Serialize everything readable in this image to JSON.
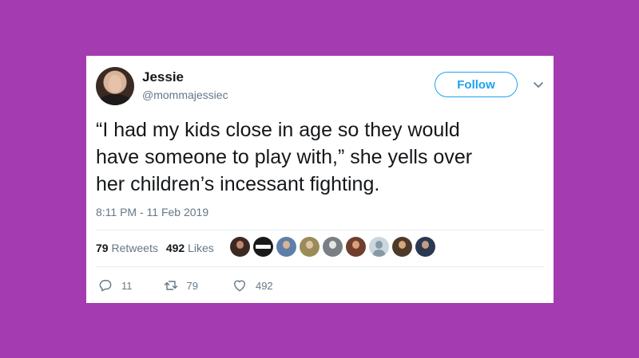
{
  "tweet": {
    "author_name": "Jessie",
    "author_handle": "@mommajessiec",
    "follow_label": "Follow",
    "text": "“I had my kids close in age so they would\nhave someone to play with,” she yells over\nher children’s incessant fighting.",
    "timestamp": "8:11 PM - 11 Feb 2019",
    "retweets_count": "79",
    "retweets_label": "Retweets",
    "likes_count": "492",
    "likes_label": "Likes",
    "reply_action_count": "11",
    "retweet_action_count": "79",
    "like_action_count": "492"
  },
  "likers": [
    {
      "icon": "avatar",
      "bg": "#3b2a22",
      "fg": "#c08a6a"
    },
    {
      "icon": "stamp-logo",
      "bg": "#1a1a1a",
      "fg": "#ffffff"
    },
    {
      "icon": "avatar",
      "bg": "#5f7fa8",
      "fg": "#d7b49a"
    },
    {
      "icon": "avatar",
      "bg": "#9a8b5a",
      "fg": "#e0c3a4"
    },
    {
      "icon": "avatar",
      "bg": "#7a7f86",
      "fg": "#e6e6e6"
    },
    {
      "icon": "avatar",
      "bg": "#6e3f2e",
      "fg": "#e09d7b"
    },
    {
      "icon": "default-avatar",
      "bg": "#ccd6dd",
      "fg": "#8899a6"
    },
    {
      "icon": "avatar",
      "bg": "#4d3a2a",
      "fg": "#d7a77a"
    },
    {
      "icon": "avatar",
      "bg": "#2b3852",
      "fg": "#c79c84"
    }
  ],
  "colors": {
    "background": "#a43bb0",
    "accent": "#1da1f2",
    "text": "#14171a",
    "muted": "#657786"
  }
}
